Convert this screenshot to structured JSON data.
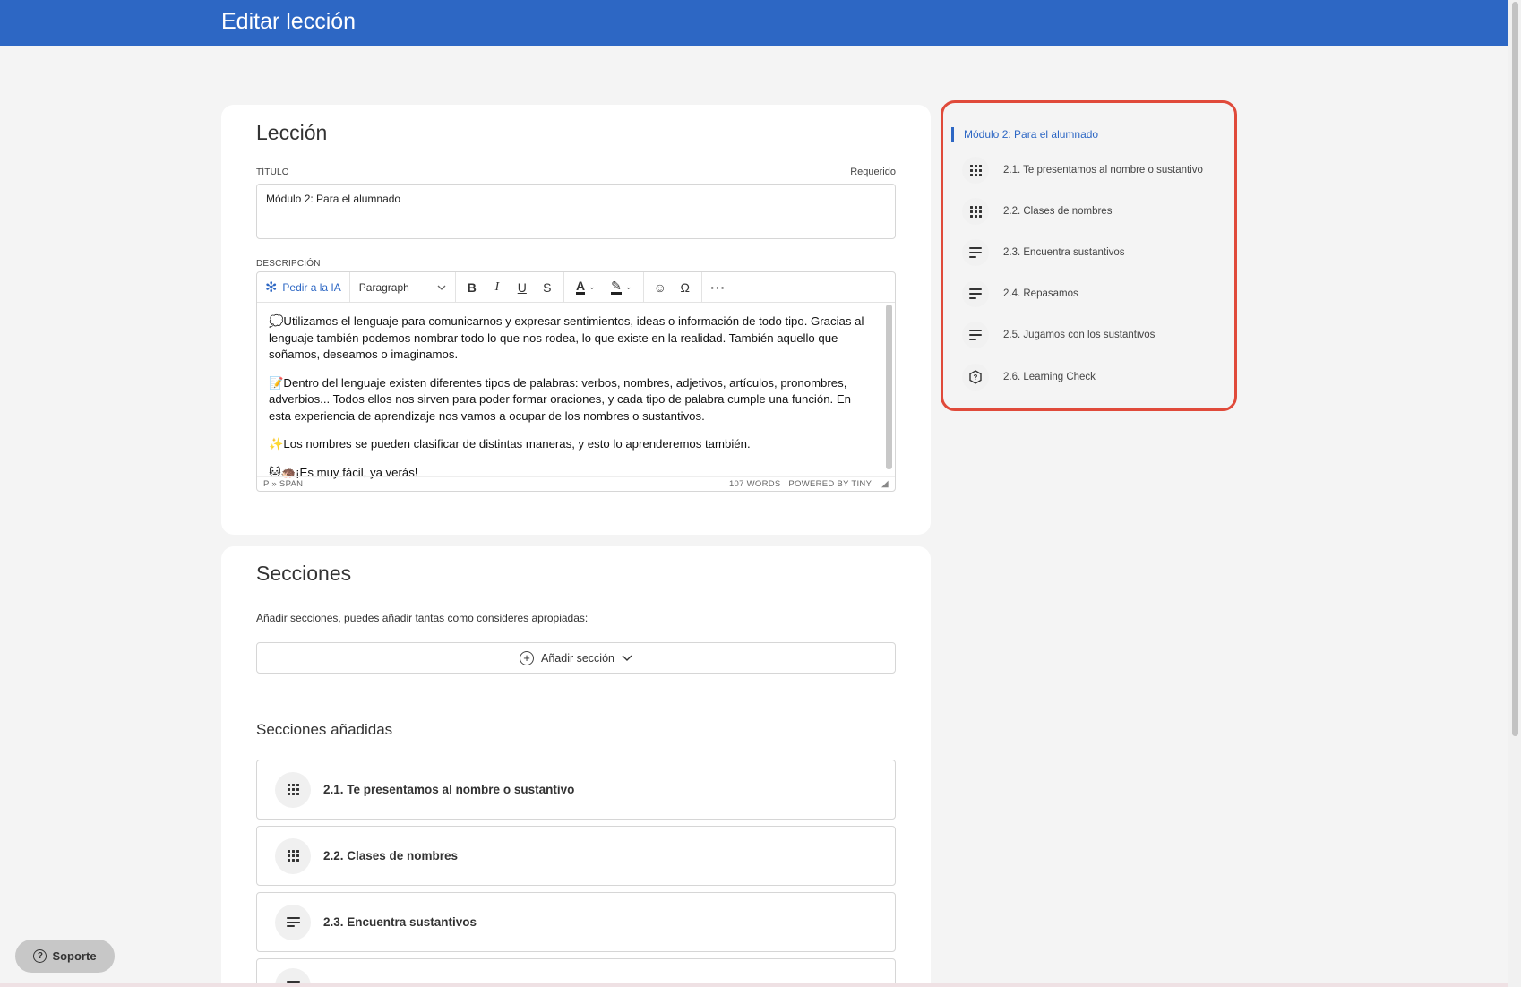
{
  "page": {
    "title": "Editar lección"
  },
  "leccion": {
    "heading": "Lección",
    "title_label": "TÍTULO",
    "required_label": "Requerido",
    "title_value": "Módulo 2: Para el alumnado",
    "description_label": "DESCRIPCIÓN",
    "editor": {
      "ai_button": "Pedir a la IA",
      "format_select": "Paragraph",
      "paragraphs": [
        "💭Utilizamos el lenguaje para comunicarnos y expresar sentimientos, ideas o información de todo tipo. Gracias al lenguaje también podemos nombrar todo lo que nos rodea, lo que existe en la realidad. También aquello que soñamos, deseamos o imaginamos.",
        "📝Dentro del lenguaje existen diferentes tipos de palabras: verbos, nombres, adjetivos, artículos, pronombres, adverbios... Todos ellos nos sirven para poder formar oraciones, y cada tipo de palabra cumple una función. En esta experiencia de aprendizaje nos vamos a ocupar de los nombres o sustantivos.",
        "✨Los nombres se pueden clasificar de distintas maneras, y esto lo aprenderemos también.",
        "🐱🦔¡Es muy fácil, ya verás!"
      ],
      "path": "P » SPAN",
      "word_count": "107 WORDS",
      "powered_by": "POWERED BY TINY"
    }
  },
  "secciones": {
    "heading": "Secciones",
    "hint": "Añadir secciones, puedes añadir tantas como consideres apropiadas:",
    "add_button": "Añadir sección",
    "added_heading": "Secciones añadidas",
    "items": [
      {
        "label": "2.1. Te presentamos al nombre o sustantivo",
        "icon": "grid-icon"
      },
      {
        "label": "2.2. Clases de nombres",
        "icon": "grid-icon"
      },
      {
        "label": "2.3. Encuentra sustantivos",
        "icon": "text-lines-icon"
      }
    ]
  },
  "outline": {
    "active": "Módulo 2: Para el alumnado",
    "items": [
      {
        "label": "2.1. Te presentamos al nombre o sustantivo",
        "icon": "grid-icon"
      },
      {
        "label": "2.2. Clases de nombres",
        "icon": "grid-icon"
      },
      {
        "label": "2.3. Encuentra sustantivos",
        "icon": "text-lines-icon"
      },
      {
        "label": "2.4. Repasamos",
        "icon": "text-lines-icon"
      },
      {
        "label": "2.5. Jugamos con los sustantivos",
        "icon": "text-lines-icon"
      },
      {
        "label": "2.6. Learning Check",
        "icon": "question-badge-icon"
      }
    ]
  },
  "support": {
    "label": "Soporte"
  },
  "colors": {
    "header": "#2d67c4",
    "highlight": "#e04a3a",
    "link": "#2d67c4"
  }
}
